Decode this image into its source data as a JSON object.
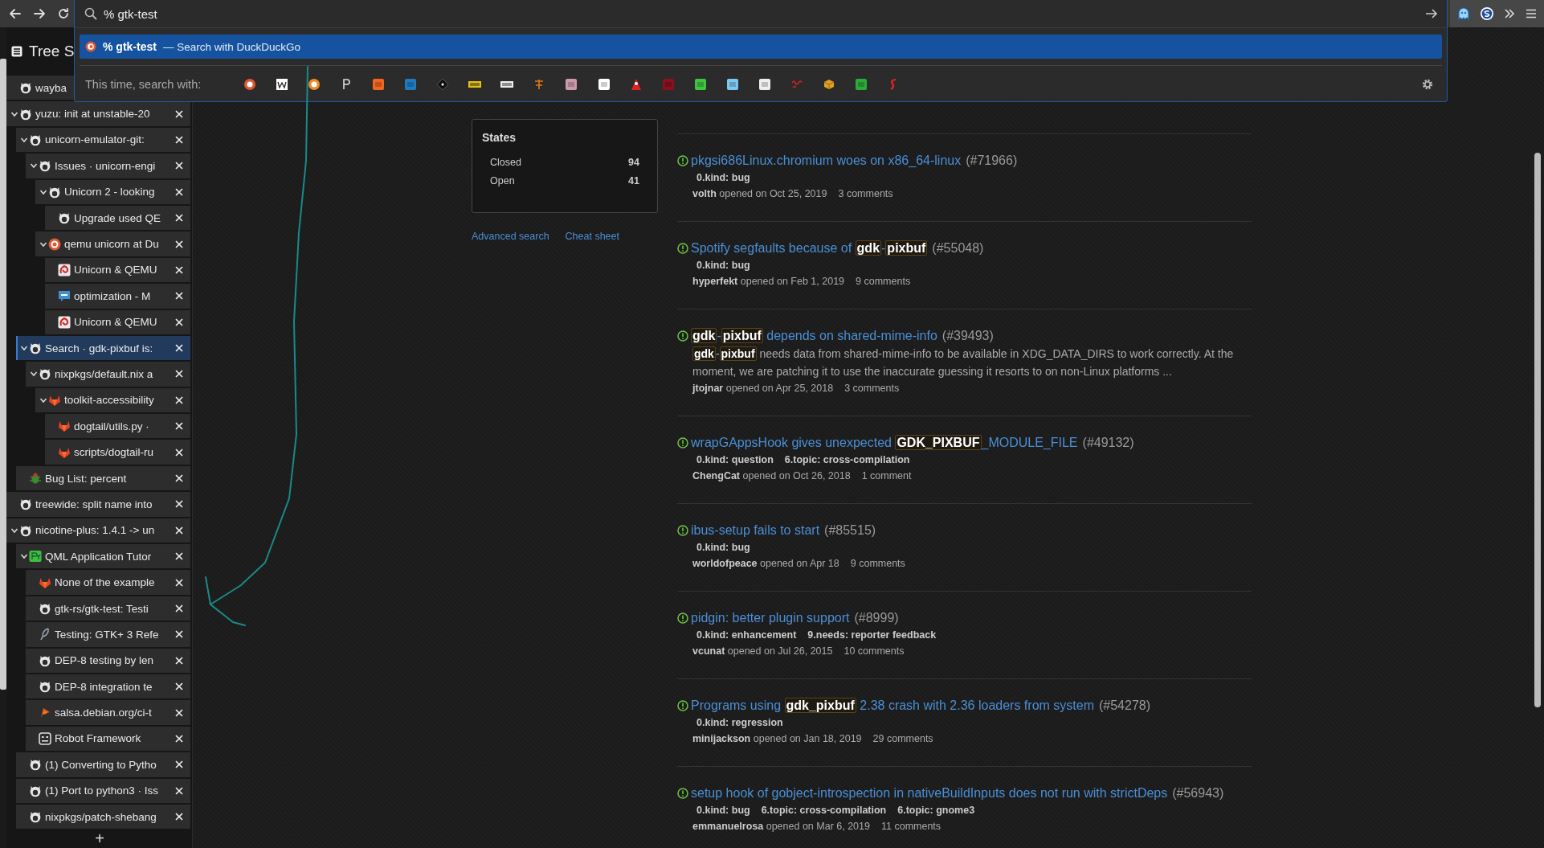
{
  "url_bar": {
    "value": "% gtk-test"
  },
  "suggestions": [
    {
      "query": "% gtk-test",
      "action": "— Search with DuckDuckGo",
      "selected": true
    }
  ],
  "one_off_label": "This time, search with:",
  "sidebar": {
    "title": "Tree S",
    "new_tab_button": "+",
    "tabs": [
      {
        "title": "wayba",
        "kind": "cat",
        "selected": false
      },
      {
        "title": "yuzu: init at unstable-20",
        "kind": "cat",
        "selected": false,
        "expanded": true,
        "children": [
          {
            "title": "unicorn-emulator-git:",
            "kind": "cat",
            "selected": false,
            "expanded": true,
            "children": [
              {
                "title": "Issues · unicorn-engi",
                "kind": "cat",
                "selected": false,
                "expanded": true,
                "children": [
                  {
                    "title": "Unicorn 2 - looking",
                    "kind": "cat",
                    "selected": false,
                    "expanded": true,
                    "children": [
                      {
                        "title": "Upgrade used QE",
                        "kind": "cat",
                        "selected": false
                      }
                    ]
                  },
                  {
                    "title": "qemu unicorn at Du",
                    "kind": "duck",
                    "selected": false,
                    "expanded": true,
                    "children": [
                      {
                        "title": "Unicorn & QEMU",
                        "kind": "tile",
                        "selected": false
                      },
                      {
                        "title": "optimization - M",
                        "kind": "chat",
                        "selected": false
                      },
                      {
                        "title": "Unicorn & QEMU",
                        "kind": "tile",
                        "selected": false
                      }
                    ]
                  }
                ]
              }
            ]
          },
          {
            "title": "Search · gdk-pixbuf is:",
            "kind": "cat",
            "selected": true,
            "expanded": true,
            "children": [
              {
                "title": "nixpkgs/default.nix a",
                "kind": "cat",
                "selected": false,
                "expanded": true,
                "children": [
                  {
                    "title": "toolkit-accessibility",
                    "kind": "fox",
                    "selected": false,
                    "expanded": true,
                    "children": [
                      {
                        "title": "dogtail/utils.py ·",
                        "kind": "fox",
                        "selected": false
                      },
                      {
                        "title": "scripts/dogtail-ru",
                        "kind": "fox",
                        "selected": false
                      }
                    ]
                  }
                ]
              }
            ]
          },
          {
            "title": "Bug List: percent",
            "kind": "bug",
            "selected": false
          }
        ]
      },
      {
        "title": "treewide: split name into",
        "kind": "cat",
        "selected": false
      },
      {
        "title": "nicotine-plus: 1.4.1 -> un",
        "kind": "cat",
        "selected": false,
        "expanded": true,
        "children": [
          {
            "title": "QML Application Tutor",
            "kind": "py",
            "selected": false,
            "expanded": true,
            "children": [
              {
                "title": "None of the example",
                "kind": "fox",
                "selected": false
              },
              {
                "title": "gtk-rs/gtk-test: Testi",
                "kind": "cat",
                "selected": false
              },
              {
                "title": "Testing: GTK+ 3 Refe",
                "kind": "feather",
                "selected": false
              },
              {
                "title": "DEP-8 testing by len",
                "kind": "cat",
                "selected": false
              },
              {
                "title": "DEP-8 integration te",
                "kind": "cat",
                "selected": false
              },
              {
                "title": "salsa.debian.org/ci-t",
                "kind": "swirl",
                "selected": false
              },
              {
                "title": "Robot Framework",
                "kind": "robot",
                "selected": false
              }
            ]
          },
          {
            "title": "(1) Converting to Pytho",
            "kind": "cat",
            "selected": false
          },
          {
            "title": "(1) Port to python3 · Iss",
            "kind": "cat",
            "selected": false
          },
          {
            "title": "nixpkgs/patch-shebang",
            "kind": "cat",
            "selected": false
          }
        ]
      }
    ]
  },
  "search": {
    "states": {
      "title": "States",
      "rows": [
        {
          "label": "Closed",
          "count": "94"
        },
        {
          "label": "Open",
          "count": "41"
        }
      ]
    },
    "links": [
      "Advanced search",
      "Cheat sheet"
    ],
    "issues": [
      {
        "title": "pkgsi686Linux.chromium woes on x86_64-linux",
        "number": "(#71966)",
        "labels": [
          "0.kind: bug"
        ],
        "meta": "**volth** opened on Oct 25, 2019",
        "comments": "3 comments"
      },
      {
        "title": "Spotify segfaults because of **gdk**-**pixbuf**",
        "number": "(#55048)",
        "labels": [
          "0.kind: bug"
        ],
        "meta": "**hyperfekt** opened on Feb 1, 2019",
        "comments": "9 comments"
      },
      {
        "title": "**gdk**-**pixbuf** depends on shared-mime-info",
        "number": "(#39493)",
        "description": "**gdk**-**pixbuf** needs data from shared-mime-info to be available in XDG_DATA_DIRS to work correctly. At the moment, we are patching it to use the inaccurate guessing it resorts to on non-Linux platforms ...",
        "meta": "**jtojnar** opened on Apr 25, 2018",
        "comments": "3 comments"
      },
      {
        "title": "wrapGAppsHook gives unexpected **GDK_PIXBUF**_MODULE_FILE",
        "number": "(#49132)",
        "labels": [
          "0.kind: question",
          "6.topic: cross-compilation"
        ],
        "meta": "**ChengCat** opened on Oct 26, 2018",
        "comments": "1 comment"
      },
      {
        "title": "ibus-setup fails to start",
        "number": "(#85515)",
        "labels": [
          "0.kind: bug"
        ],
        "meta": "**worldofpeace** opened on Apr 18",
        "comments": "9 comments"
      },
      {
        "title": "pidgin: better plugin support",
        "number": "(#8999)",
        "labels": [
          "0.kind: enhancement",
          "9.needs: reporter feedback"
        ],
        "meta": "**vcunat** opened on Jul 26, 2015",
        "comments": "10 comments"
      },
      {
        "title": "Programs using **gdk_pixbuf** 2.38 crash with 2.36 loaders from system",
        "number": "(#54278)",
        "labels": [
          "0.kind: regression"
        ],
        "meta": "**minijackson** opened on Jan 18, 2019",
        "comments": "29 comments"
      },
      {
        "title": "setup hook of gobject-introspection in nativeBuildInputs does not run with strictDeps",
        "number": "(#56943)",
        "labels": [
          "0.kind: bug",
          "6.topic: cross-compilation",
          "6.topic: gnome3"
        ],
        "meta": "**emmanuelrosa** opened on Mar 6, 2019",
        "comments": "11 comments"
      }
    ]
  }
}
